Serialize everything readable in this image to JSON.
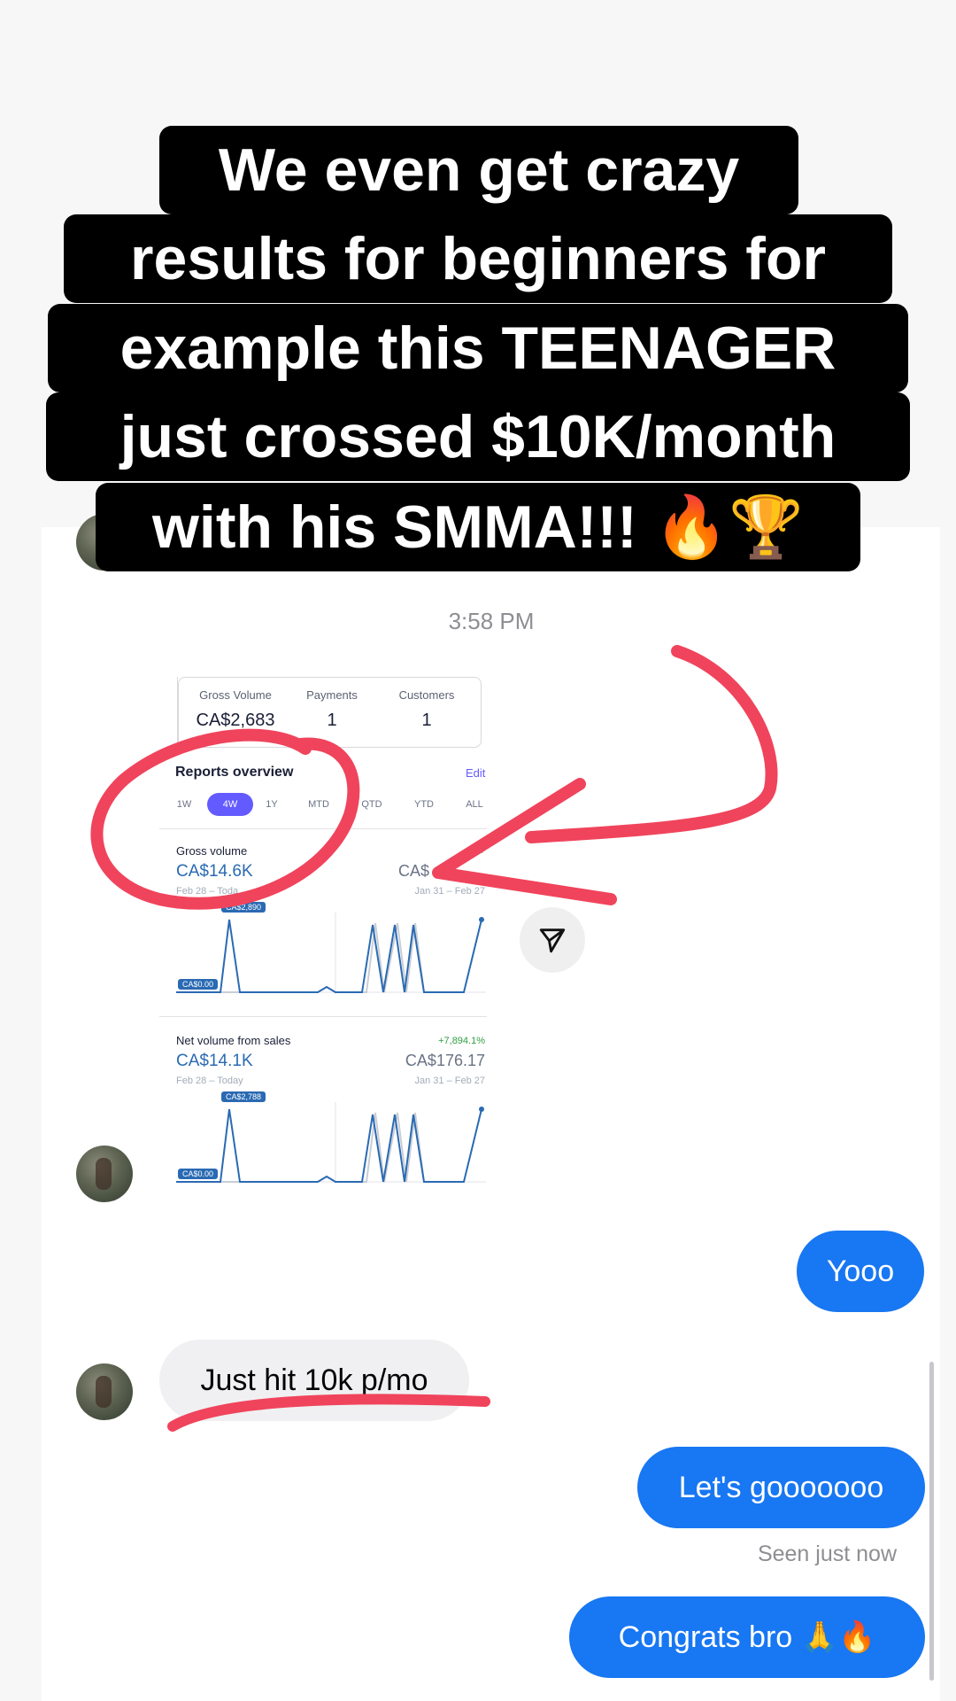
{
  "headline": {
    "lines": [
      "We even get crazy",
      "results for beginners for",
      "example this TEENAGER",
      "just crossed $10K/month",
      "with his SMMA!!! 🔥🏆"
    ]
  },
  "conversation": {
    "timestamp": "3:58 PM",
    "shared_screenshot": {
      "summary": [
        {
          "label": "Gross Volume",
          "value": "CA$2,683"
        },
        {
          "label": "Payments",
          "value": "1"
        },
        {
          "label": "Customers",
          "value": "1"
        }
      ],
      "reports_title": "Reports overview",
      "edit_label": "Edit",
      "ranges": [
        "1W",
        "4W",
        "1Y",
        "MTD",
        "QTD",
        "YTD",
        "ALL"
      ],
      "active_range": "4W",
      "gross_volume": {
        "label": "Gross volume",
        "current": "CA$14.6K",
        "previous": "CA$",
        "pct": "+",
        "current_period": "Feb 28 – Toda",
        "previous_period": "Jan 31 – Feb 27",
        "peak_tag": "CA$2,890",
        "zero_tag": "CA$0.00"
      },
      "net_volume": {
        "label": "Net volume from sales",
        "current": "CA$14.1K",
        "previous": "CA$176.17",
        "pct": "+7,894.1%",
        "current_period": "Feb 28 – Today",
        "previous_period": "Jan 31 – Feb 27",
        "peak_tag": "CA$2,788",
        "zero_tag": "CA$0.00"
      }
    },
    "messages": {
      "yooo": "Yooo",
      "just_hit": "Just hit 10k p/mo",
      "lets_go": "Let's gooooooo",
      "seen": "Seen just now",
      "congrats": "Congrats bro 🙏🔥"
    }
  },
  "colors": {
    "outgoing_bubble": "#1877f2",
    "incoming_bubble": "#f0f0f2",
    "annotation_red": "#f0445c",
    "stripe_accent": "#635bff",
    "chart_line": "#2a6ab3"
  }
}
